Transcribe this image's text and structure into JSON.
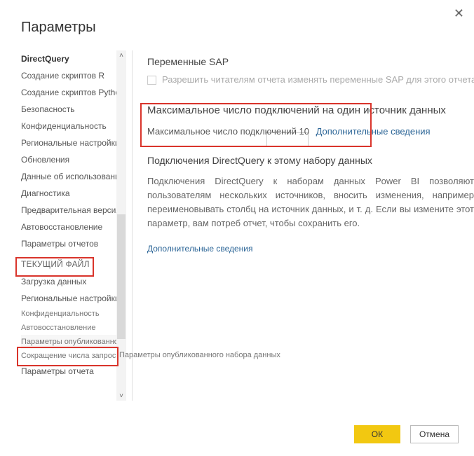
{
  "title": "Параметры",
  "close_glyph": "✕",
  "sidebar": {
    "items": [
      {
        "label": "DirectQuery",
        "bold": true
      },
      {
        "label": "Создание скриптов R"
      },
      {
        "label": "Создание скриптов Python"
      },
      {
        "label": "Безопасность"
      },
      {
        "label": "Конфиденциальность"
      },
      {
        "label": "Региональные настройки"
      },
      {
        "label": "Обновления"
      },
      {
        "label": "Данные об использовании"
      },
      {
        "label": "Диагностика"
      },
      {
        "label": "Предварительная версия функций"
      },
      {
        "label": "Автовосстановление"
      },
      {
        "label": "Параметры отчетов"
      }
    ],
    "section_header": "ТЕКУЩИЙ ФАЙЛ",
    "items2": [
      {
        "label": "Загрузка данных"
      },
      {
        "label": "Региональные настройки"
      },
      {
        "label": "Конфиденциальность",
        "small": true
      },
      {
        "label": "Автовосстановление",
        "small": true
      },
      {
        "label": "Параметры опубликованного набора данных",
        "small": true,
        "selected": true
      },
      {
        "label": "Сокращение числа запросов",
        "small": true
      },
      {
        "label": "Параметры отчета"
      }
    ],
    "scroll_top_glyph": "˄",
    "scroll_bottom_glyph": "˅"
  },
  "content": {
    "sap_title": "Переменные SAP",
    "sap_checkbox_label": "Разрешить читателям отчета изменять переменные SAP для этого отчета. По",
    "maxconn_title": "Максимальное число подключений на один источник данных",
    "maxconn_label": "Максимальное число подключений",
    "maxconn_value": "10",
    "more_link": "Дополнительные сведения",
    "dq_title": "Подключения DirectQuery к этому набору данных",
    "dq_para": "Подключения DirectQuery к наборам данных Power BI позволяют пользователям нескольких источников, вносить изменения, например переименовывать столбц на источник данных, и т. д. Если вы измените этот параметр, вам потреб отчет, чтобы сохранить его.",
    "more_link2": "Дополнительные сведения"
  },
  "footer": {
    "ok": "ОК",
    "cancel": "Отмена"
  }
}
